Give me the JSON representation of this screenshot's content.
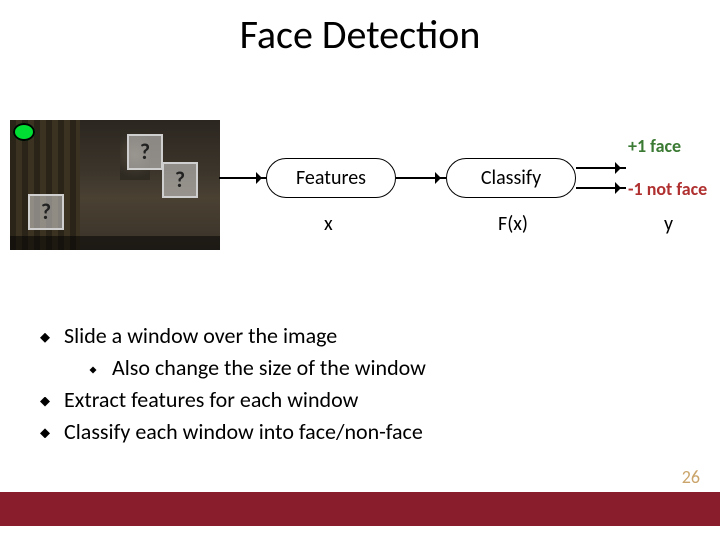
{
  "title": "Face Detection",
  "image": {
    "window_marker": "?",
    "windows": [
      "q1",
      "q2",
      "q3"
    ]
  },
  "pipeline": {
    "features_label": "Features",
    "classify_label": "Classify",
    "x_label": "x",
    "fx_label": "F(x)",
    "y_label": "y"
  },
  "outputs": {
    "positive": "+1 face",
    "negative": "-1 not face"
  },
  "bullets": [
    {
      "text": "Slide a window over the image",
      "children": [
        {
          "text": "Also change the size of the window"
        }
      ]
    },
    {
      "text": "Extract features for each window"
    },
    {
      "text": "Classify each window into face/non-face"
    }
  ],
  "page_number": "26"
}
